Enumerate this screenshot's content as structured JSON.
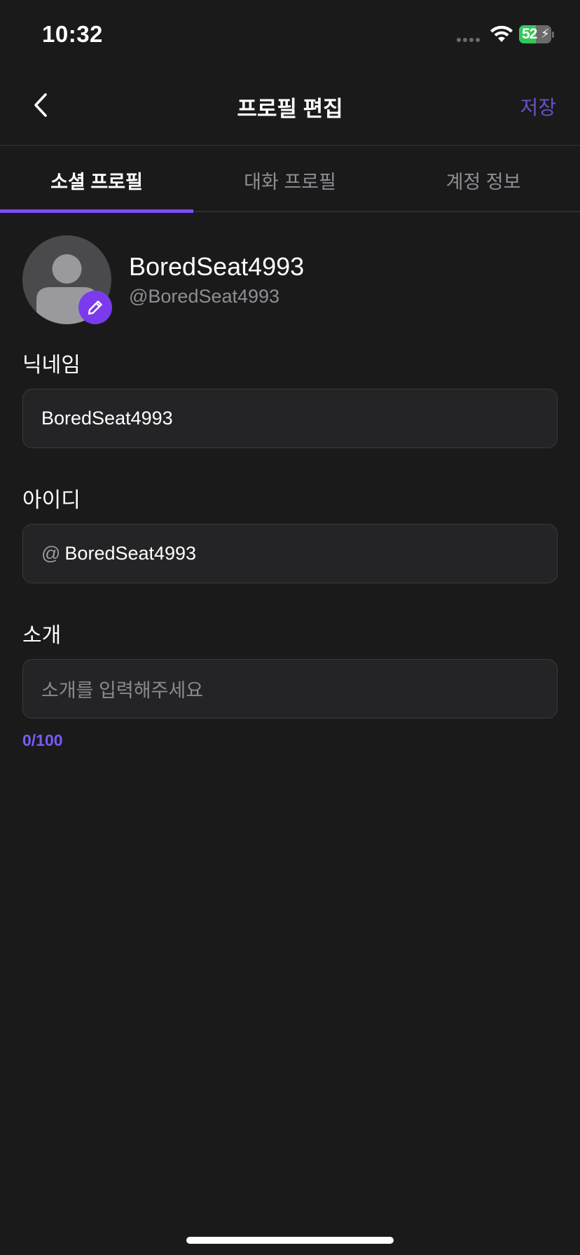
{
  "status_bar": {
    "time": "10:32",
    "battery_percent": "52",
    "battery_level": 0.52,
    "charging": true
  },
  "nav": {
    "title": "프로필 편집",
    "save_label": "저장",
    "back_icon": "chevron-left-icon"
  },
  "tabs": [
    {
      "label": "소셜 프로필",
      "active": true
    },
    {
      "label": "대화 프로필",
      "active": false
    },
    {
      "label": "계정 정보",
      "active": false
    }
  ],
  "profile": {
    "display_name": "BoredSeat4993",
    "handle": "@BoredSeat4993",
    "edit_icon": "pencil-icon"
  },
  "form": {
    "nickname": {
      "label": "닉네임",
      "value": "BoredSeat4993"
    },
    "user_id": {
      "label": "아이디",
      "prefix": "@",
      "value": "BoredSeat4993"
    },
    "bio": {
      "label": "소개",
      "placeholder": "소개를 입력해주세요",
      "value": "",
      "counter": "0/100"
    }
  },
  "colors": {
    "accent": "#7c4dff",
    "save_text": "#6a50c9",
    "counter_text": "#7a5af8",
    "background": "#1a1a1b",
    "field_background": "#242426",
    "battery_green": "#34c759"
  }
}
